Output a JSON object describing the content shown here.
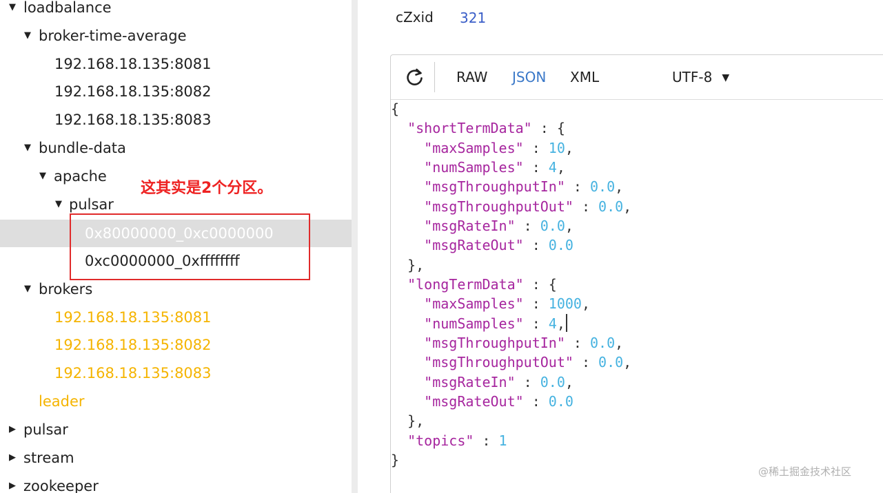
{
  "tree": {
    "nodes": [
      {
        "label": "loadbalance",
        "expanded": true
      },
      {
        "label": "broker-time-average",
        "expanded": true
      },
      {
        "label": "192.168.18.135:8081"
      },
      {
        "label": "192.168.18.135:8082"
      },
      {
        "label": "192.168.18.135:8083"
      },
      {
        "label": "bundle-data",
        "expanded": true
      },
      {
        "label": "apache",
        "expanded": true
      },
      {
        "label": "pulsar",
        "expanded": true
      },
      {
        "label": "0x80000000_0xc0000000",
        "selected": true
      },
      {
        "label": "0xc0000000_0xffffffff"
      },
      {
        "label": "brokers",
        "expanded": true
      },
      {
        "label": "192.168.18.135:8081",
        "state": "ephemeral"
      },
      {
        "label": "192.168.18.135:8082",
        "state": "ephemeral"
      },
      {
        "label": "192.168.18.135:8083",
        "state": "ephemeral"
      },
      {
        "label": "leader",
        "state": "ephemeral"
      },
      {
        "label": "pulsar",
        "expanded": false
      },
      {
        "label": "stream",
        "expanded": false
      },
      {
        "label": "zookeeper",
        "expanded": false
      }
    ],
    "icons": {
      "expanded": "caret-down-icon",
      "collapsed": "caret-right-icon"
    }
  },
  "annotation": {
    "text": "这其实是2个分区。",
    "color": "#ee2222"
  },
  "detail": {
    "key": "cZxid",
    "value": "321"
  },
  "viewer": {
    "refresh_icon": "refresh-icon",
    "formats": [
      "RAW",
      "JSON",
      "XML"
    ],
    "active_format": "JSON",
    "encoding": "UTF-8",
    "encoding_icon": "caret-down-icon",
    "json": {
      "open": "{",
      "close": "}",
      "sections": [
        {
          "key": "\"shortTermData\"",
          "fields": [
            {
              "key": "\"maxSamples\"",
              "value": "10"
            },
            {
              "key": "\"numSamples\"",
              "value": "4"
            },
            {
              "key": "\"msgThroughputIn\"",
              "value": "0.0"
            },
            {
              "key": "\"msgThroughputOut\"",
              "value": "0.0"
            },
            {
              "key": "\"msgRateIn\"",
              "value": "0.0"
            },
            {
              "key": "\"msgRateOut\"",
              "value": "0.0"
            }
          ]
        },
        {
          "key": "\"longTermData\"",
          "fields": [
            {
              "key": "\"maxSamples\"",
              "value": "1000"
            },
            {
              "key": "\"numSamples\"",
              "value": "4"
            },
            {
              "key": "\"msgThroughputIn\"",
              "value": "0.0"
            },
            {
              "key": "\"msgThroughputOut\"",
              "value": "0.0"
            },
            {
              "key": "\"msgRateIn\"",
              "value": "0.0"
            },
            {
              "key": "\"msgRateOut\"",
              "value": "0.0"
            }
          ]
        }
      ],
      "last_key": "\"topics\"",
      "last_value": "1"
    }
  },
  "watermark": "@稀土掘金技术社区",
  "colors": {
    "accent": "#3a78c8",
    "ephemeral_node": "#f5b400",
    "json_key": "#a6259e",
    "json_number": "#45b2e0",
    "selection_bg": "#dedede",
    "annotation_box": "#e02a2a"
  }
}
